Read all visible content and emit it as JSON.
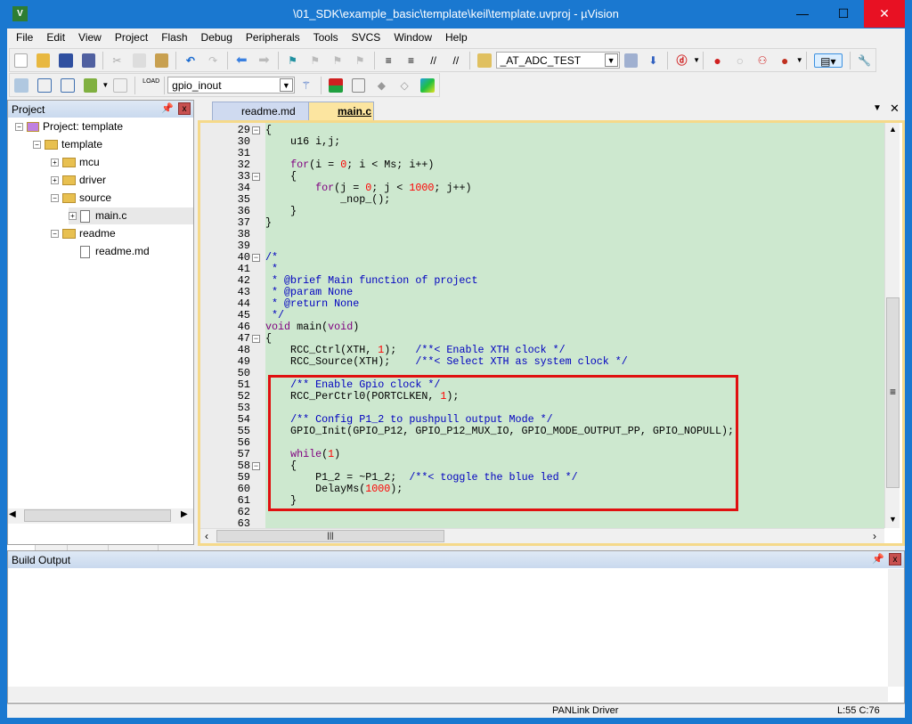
{
  "window": {
    "title": "\\01_SDK\\example_basic\\template\\keil\\template.uvproj - µVision",
    "minimize": "—",
    "maximize": "☐",
    "close": "✕"
  },
  "menu": [
    "File",
    "Edit",
    "View",
    "Project",
    "Flash",
    "Debug",
    "Peripherals",
    "Tools",
    "SVCS",
    "Window",
    "Help"
  ],
  "toolbar1": {
    "find_combo": "_AT_ADC_TEST"
  },
  "toolbar2": {
    "target_combo": "gpio_inout",
    "load_label": "LOAD"
  },
  "project_panel": {
    "title": "Project",
    "tree": [
      {
        "label": "Project: template",
        "depth": 0,
        "type": "project",
        "exp": "−"
      },
      {
        "label": "template",
        "depth": 1,
        "type": "folder",
        "exp": "−"
      },
      {
        "label": "mcu",
        "depth": 2,
        "type": "folder",
        "exp": "+"
      },
      {
        "label": "driver",
        "depth": 2,
        "type": "folder",
        "exp": "+"
      },
      {
        "label": "source",
        "depth": 2,
        "type": "folder",
        "exp": "−"
      },
      {
        "label": "main.c",
        "depth": 3,
        "type": "file",
        "exp": "+",
        "selected": true
      },
      {
        "label": "readme",
        "depth": 2,
        "type": "folder",
        "exp": "−"
      },
      {
        "label": "readme.md",
        "depth": 3,
        "type": "file",
        "exp": ""
      }
    ],
    "tabs": [
      "Pr...",
      "Bo...",
      "{} Fu...",
      "0→ Te..."
    ]
  },
  "editor": {
    "tabs": [
      {
        "label": "readme.md",
        "active": false
      },
      {
        "label": "main.c",
        "active": true
      }
    ],
    "lines": [
      [
        29,
        [
          [
            "p",
            "{"
          ]
        ],
        "box"
      ],
      [
        30,
        [
          [
            "p",
            "    u16 i,j;"
          ]
        ]
      ],
      [
        31,
        []
      ],
      [
        32,
        [
          [
            "p",
            "    "
          ],
          [
            "kw",
            "for"
          ],
          [
            "p",
            "(i = "
          ],
          [
            "num",
            "0"
          ],
          [
            "p",
            "; i < Ms; i++)"
          ]
        ]
      ],
      [
        33,
        [
          [
            "p",
            "    {"
          ]
        ],
        "box"
      ],
      [
        34,
        [
          [
            "p",
            "        "
          ],
          [
            "kw",
            "for"
          ],
          [
            "p",
            "(j = "
          ],
          [
            "num",
            "0"
          ],
          [
            "p",
            "; j < "
          ],
          [
            "num",
            "1000"
          ],
          [
            "p",
            "; j++)"
          ]
        ]
      ],
      [
        35,
        [
          [
            "p",
            "            _nop_();"
          ]
        ]
      ],
      [
        36,
        [
          [
            "p",
            "    }"
          ]
        ]
      ],
      [
        37,
        [
          [
            "p",
            "}"
          ]
        ]
      ],
      [
        38,
        []
      ],
      [
        39,
        []
      ],
      [
        40,
        [
          [
            "cm",
            "/*"
          ]
        ],
        "box"
      ],
      [
        41,
        [
          [
            "cm",
            " *"
          ]
        ]
      ],
      [
        42,
        [
          [
            "cm",
            " * @brief Main function of project"
          ]
        ]
      ],
      [
        43,
        [
          [
            "cm",
            " * @param None"
          ]
        ]
      ],
      [
        44,
        [
          [
            "cm",
            " * @return None"
          ]
        ]
      ],
      [
        45,
        [
          [
            "cm",
            " */"
          ]
        ]
      ],
      [
        46,
        [
          [
            "kw",
            "void"
          ],
          [
            "p",
            " main("
          ],
          [
            "kw",
            "void"
          ],
          [
            "p",
            ")"
          ]
        ]
      ],
      [
        47,
        [
          [
            "p",
            "{"
          ]
        ],
        "box"
      ],
      [
        48,
        [
          [
            "p",
            "    RCC_Ctrl(XTH, "
          ],
          [
            "num",
            "1"
          ],
          [
            "p",
            ");   "
          ],
          [
            "cm",
            "/**< Enable XTH clock */"
          ]
        ]
      ],
      [
        49,
        [
          [
            "p",
            "    RCC_Source(XTH);    "
          ],
          [
            "cm",
            "/**< Select XTH as system clock */"
          ]
        ]
      ],
      [
        50,
        []
      ],
      [
        51,
        [
          [
            "p",
            "    "
          ],
          [
            "cm",
            "/** Enable Gpio clock */"
          ]
        ]
      ],
      [
        52,
        [
          [
            "p",
            "    RCC_PerCtrl0(PORTCLKEN, "
          ],
          [
            "num",
            "1"
          ],
          [
            "p",
            ");"
          ]
        ]
      ],
      [
        53,
        []
      ],
      [
        54,
        [
          [
            "p",
            "    "
          ],
          [
            "cm",
            "/** Config P1_2 to pushpull output Mode */"
          ]
        ]
      ],
      [
        55,
        [
          [
            "p",
            "    GPIO_Init(GPIO_P12, GPIO_P12_MUX_IO, GPIO_MODE_OUTPUT_PP, GPIO_NOPULL);"
          ]
        ]
      ],
      [
        56,
        []
      ],
      [
        57,
        [
          [
            "p",
            "    "
          ],
          [
            "kw",
            "while"
          ],
          [
            "p",
            "("
          ],
          [
            "num",
            "1"
          ],
          [
            "p",
            ")"
          ]
        ]
      ],
      [
        58,
        [
          [
            "p",
            "    {"
          ]
        ],
        "box"
      ],
      [
        59,
        [
          [
            "p",
            "        P1_2 = ~P1_2;  "
          ],
          [
            "cm",
            "/**< toggle the blue led */"
          ]
        ]
      ],
      [
        60,
        [
          [
            "p",
            "        DelayMs("
          ],
          [
            "num",
            "1000"
          ],
          [
            "p",
            ");"
          ]
        ]
      ],
      [
        61,
        [
          [
            "p",
            "    }"
          ]
        ]
      ],
      [
        62,
        []
      ],
      [
        63,
        []
      ]
    ]
  },
  "build_output": {
    "title": "Build Output"
  },
  "status": {
    "driver": "PANLink Driver",
    "position": "L:55 C:76"
  },
  "colors": {
    "title_bar": "#1a78d0",
    "code_bg": "#cde8cf",
    "highlight_box": "#e01010"
  }
}
